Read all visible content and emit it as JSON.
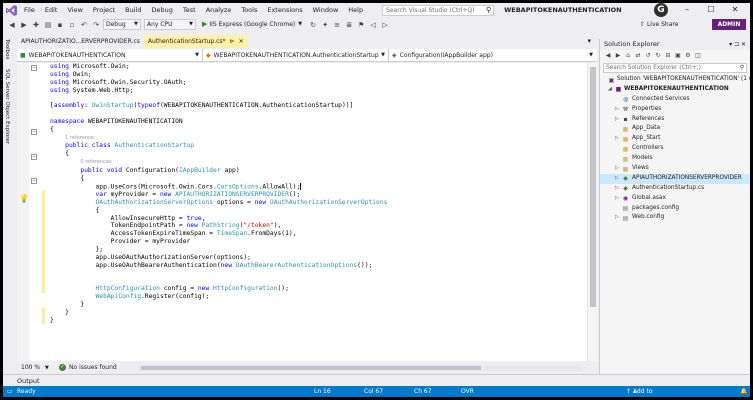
{
  "menubar": {
    "items": [
      "File",
      "Edit",
      "View",
      "Project",
      "Build",
      "Debug",
      "Test",
      "Analyze",
      "Tools",
      "Extensions",
      "Window",
      "Help"
    ],
    "search_placeholder": "Search Visual Studio (Ctrl+Q)",
    "title": "WEBAPITOKENAUTHENTICATION",
    "avatar_letter": "G"
  },
  "toolbar": {
    "config": "Debug",
    "platform": "Any CPU",
    "run_label": "IIS Express (Google Chrome)",
    "live_share": "Live Share",
    "admin": "ADMIN"
  },
  "left_strip": {
    "tabs": [
      "Toolbox",
      "SQL Server Object Explorer"
    ]
  },
  "doc_tabs": [
    {
      "label": "APIAUTHORIZATIO...ERVERPROVIDER.cs"
    },
    {
      "label": "AuthenticationStartup.cs*"
    }
  ],
  "navbar": {
    "project": "WEBAPITOKENAUTHENTICATION",
    "type": "WEBAPITOKENAUTHENTICATION.AuthenticationStartup",
    "member": "Configuration(IAppBuilder app)"
  },
  "editor": {
    "references_class": "1 reference",
    "references_method": "0 references",
    "lines": {
      "u1": "Microsoft.Owin;",
      "u2": "Owin;",
      "u3": "Microsoft.Owin.Security.OAuth;",
      "u4": "System.Web.Http;",
      "assembly_attr": "OwinStartup",
      "assembly_arg": "WEBAPITOKENAUTHENTICATION.AuthenticationStartup",
      "namespace": "WEBAPITOKENAUTHENTICATION",
      "class": "AuthenticationStartup",
      "method": "Configuration",
      "param_type": "IAppBuilder",
      "param": "app",
      "use_cors": "app.UseCors(Microsoft.Owin.Cors.",
      "cors_opts": "CorsOptions",
      "allow_all": ".AllowAll);",
      "provider_type": "APIAUTHORIZATIONSERVERPROVIDER",
      "options_type": "OAuthAuthorizationServerOptions",
      "allow_insecure": "AllowInsecureHttp = ",
      "token_path": "TokenEndpointPath = ",
      "token_path_type": "PathString",
      "token_path_val": "\"/token\"",
      "expire": "AccessTokenExpireTimeSpan = ",
      "timespan": "TimeSpan",
      "from_days": ".FromDays(1),",
      "provider_line": "Provider = myProvider",
      "use_server": "app.UseOAuthAuthorizationServer(options);",
      "use_bearer": "app.UseOAuthBearerAuthentication(",
      "bearer_type": "OAuthBearerAuthenticationOptions",
      "http_config": "HttpConfiguration",
      "webapi_config": "WebApiConfig",
      "register": ".Register(config);"
    }
  },
  "editor_status": {
    "zoom": "100 %",
    "issues": "No issues found"
  },
  "output": {
    "label": "Output"
  },
  "statusbar": {
    "ready": "Ready",
    "ln": "Ln 16",
    "col": "Col 67",
    "ch": "Ch 67",
    "mode": "OVR",
    "source_control": "Add to Source Control"
  },
  "solution_explorer": {
    "title": "Solution Explorer",
    "search_placeholder": "Search Solution Explorer (Ctrl+;)",
    "items": [
      {
        "label": "Solution 'WEBAPITOKENAUTHENTICATION' (1 o",
        "icon": "solution-icon"
      },
      {
        "label": "WEBAPITOKENAUTHENTICATION",
        "icon": "csharp-project-icon"
      },
      {
        "label": "Connected Services",
        "icon": "connected-services-icon"
      },
      {
        "label": "Properties",
        "icon": "wrench-icon"
      },
      {
        "label": "References",
        "icon": "references-icon"
      },
      {
        "label": "App_Data",
        "icon": "folder-icon"
      },
      {
        "label": "App_Start",
        "icon": "folder-icon"
      },
      {
        "label": "Controllers",
        "icon": "folder-icon"
      },
      {
        "label": "Models",
        "icon": "folder-icon"
      },
      {
        "label": "Views",
        "icon": "folder-icon"
      },
      {
        "label": "APIAUTHORIZATIONSERVERPROVIDER",
        "icon": "csharp-file-icon"
      },
      {
        "label": "AuthenticationStartup.cs",
        "icon": "csharp-file-icon"
      },
      {
        "label": "Global.asax",
        "icon": "asax-file-icon"
      },
      {
        "label": "packages.config",
        "icon": "config-file-icon"
      },
      {
        "label": "Web.config",
        "icon": "config-file-icon"
      }
    ]
  }
}
